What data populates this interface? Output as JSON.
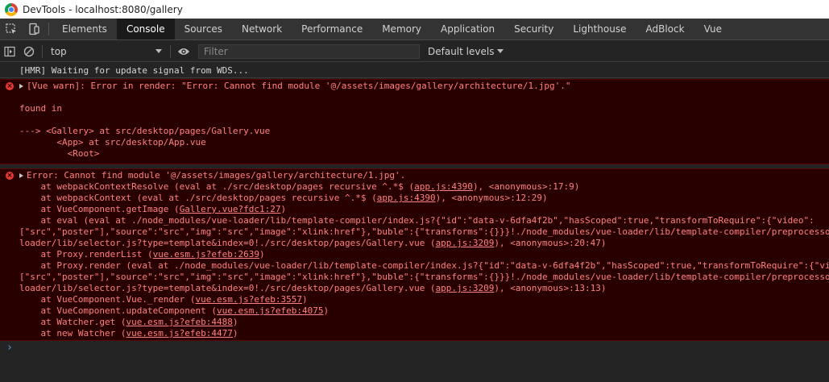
{
  "window": {
    "title": "DevTools - localhost:8080/gallery"
  },
  "tabs": [
    {
      "label": "Elements"
    },
    {
      "label": "Console"
    },
    {
      "label": "Sources"
    },
    {
      "label": "Network"
    },
    {
      "label": "Performance"
    },
    {
      "label": "Memory"
    },
    {
      "label": "Application"
    },
    {
      "label": "Security"
    },
    {
      "label": "Lighthouse"
    },
    {
      "label": "AdBlock"
    },
    {
      "label": "Vue"
    }
  ],
  "active_tab": "Console",
  "toolbar": {
    "context": "top",
    "filter_placeholder": "Filter",
    "levels": "Default levels"
  },
  "console": {
    "info": "[HMR] Waiting for update signal from WDS...",
    "error1": {
      "lines": [
        "[Vue warn]: Error in render: \"Error: Cannot find module '@/assets/images/gallery/architecture/1.jpg'.\"",
        "",
        "found in",
        "",
        "---> <Gallery> at src/desktop/pages/Gallery.vue",
        "       <App> at src/desktop/App.vue",
        "         <Root>"
      ]
    },
    "error2": {
      "head": "Error: Cannot find module '@/assets/images/gallery/architecture/1.jpg'.",
      "stack": [
        {
          "pre": "    at webpackContextResolve (eval at ./src/desktop/pages recursive ^.*$ (",
          "link": "app.js:4390",
          "post": "), <anonymous>:17:9)"
        },
        {
          "pre": "    at webpackContext (eval at ./src/desktop/pages recursive ^.*$ (",
          "link": "app.js:4390",
          "post": "), <anonymous>:12:29)"
        },
        {
          "pre": "    at VueComponent.getImage (",
          "link": "Gallery.vue?fdc1:27",
          "post": ")"
        },
        {
          "pre": "    at eval (eval at ./node_modules/vue-loader/lib/template-compiler/index.js?{\"id\":\"data-v-6dfa4f2b\",\"hasScoped\":true,\"transformToRequire\":{\"video\":",
          "link": "",
          "post": ""
        },
        {
          "pre": "[\"src\",\"poster\"],\"source\":\"src\",\"img\":\"src\",\"image\":\"xlink:href\"},\"buble\":{\"transforms\":{}}}!./node_modules/vue-loader/lib/template-compiler/preprocessor",
          "link": "",
          "post": ""
        },
        {
          "pre": "loader/lib/selector.js?type=template&index=0!./src/desktop/pages/Gallery.vue (",
          "link": "app.js:3209",
          "post": "), <anonymous>:20:47)"
        },
        {
          "pre": "    at Proxy.renderList (",
          "link": "vue.esm.js?efeb:2639",
          "post": ")"
        },
        {
          "pre": "    at Proxy.render (eval at ./node_modules/vue-loader/lib/template-compiler/index.js?{\"id\":\"data-v-6dfa4f2b\",\"hasScoped\":true,\"transformToRequire\":{\"vid",
          "link": "",
          "post": ""
        },
        {
          "pre": "[\"src\",\"poster\"],\"source\":\"src\",\"img\":\"src\",\"image\":\"xlink:href\"},\"buble\":{\"transforms\":{}}}!./node_modules/vue-loader/lib/template-compiler/preprocessor",
          "link": "",
          "post": ""
        },
        {
          "pre": "loader/lib/selector.js?type=template&index=0!./src/desktop/pages/Gallery.vue (",
          "link": "app.js:3209",
          "post": "), <anonymous>:13:13)"
        },
        {
          "pre": "    at VueComponent.Vue._render (",
          "link": "vue.esm.js?efeb:3557",
          "post": ")"
        },
        {
          "pre": "    at VueComponent.updateComponent (",
          "link": "vue.esm.js?efeb:4075",
          "post": ")"
        },
        {
          "pre": "    at Watcher.get (",
          "link": "vue.esm.js?efeb:4488",
          "post": ")"
        },
        {
          "pre": "    at new Watcher (",
          "link": "vue.esm.js?efeb:4477",
          "post": ")"
        }
      ]
    },
    "prompt": "›"
  },
  "colors": {
    "error_bg": "#290000",
    "error_text": "#ff8080",
    "link_prompt": "#4e9ee8"
  },
  "icons": [
    "chrome-logo-icon",
    "inspect-element-icon",
    "device-toolbar-icon",
    "sidebar-toggle-icon",
    "clear-console-icon",
    "chevron-down-icon",
    "eye-icon",
    "error-icon",
    "expand-triangle-icon"
  ]
}
